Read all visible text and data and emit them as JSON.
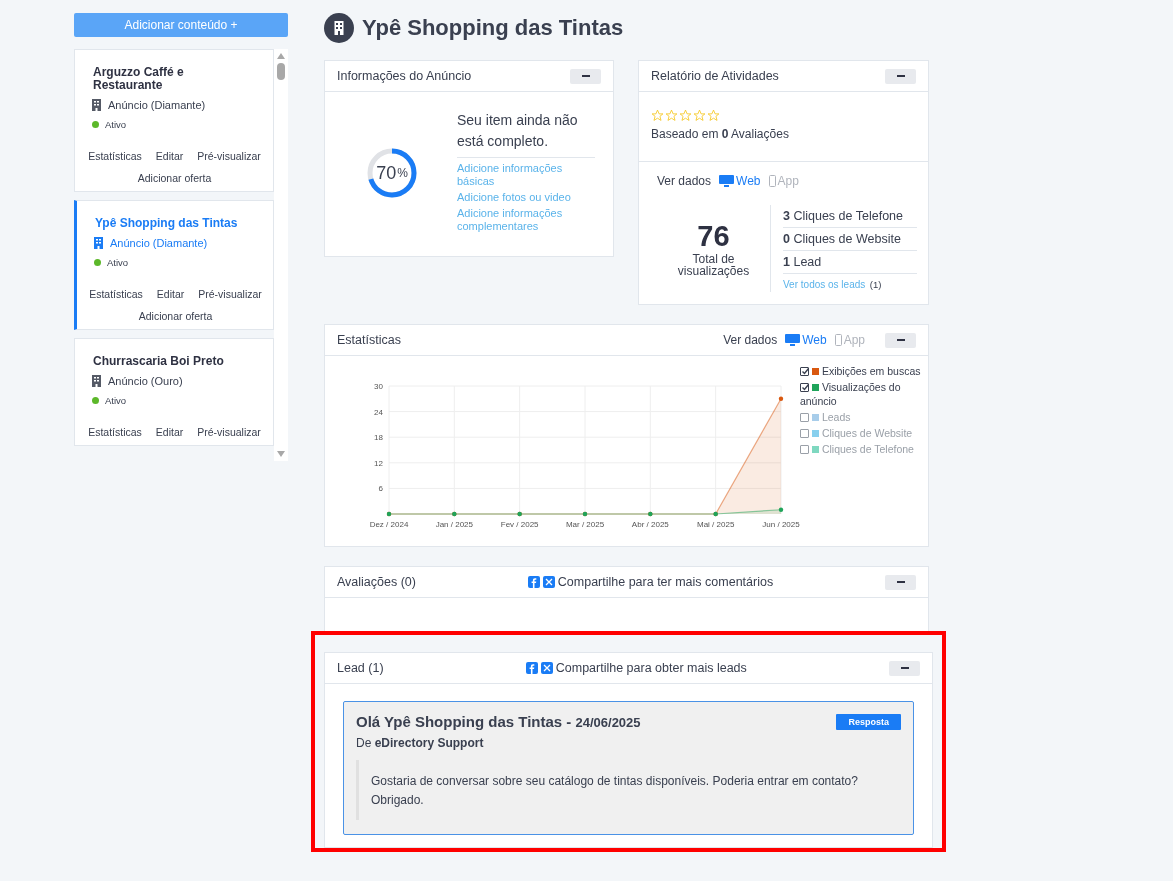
{
  "sidebar": {
    "add_button": "Adicionar conteúdo +",
    "cards": [
      {
        "title": "Arguzzo Caffé e Restaurante",
        "plan": "Anúncio (Diamante)",
        "status": "Ativo",
        "selected": false,
        "actions": [
          "Estatísticas",
          "Editar",
          "Pré-visualizar",
          "Adicionar oferta"
        ]
      },
      {
        "title": "Ypê Shopping das Tintas",
        "plan": "Anúncio (Diamante)",
        "status": "Ativo",
        "selected": true,
        "actions": [
          "Estatísticas",
          "Editar",
          "Pré-visualizar",
          "Adicionar oferta"
        ]
      },
      {
        "title": "Churrascaria Boi Preto",
        "plan": "Anúncio (Ouro)",
        "status": "Ativo",
        "selected": false,
        "actions": [
          "Estatísticas",
          "Editar",
          "Pré-visualizar"
        ]
      }
    ]
  },
  "page_title": "Ypê Shopping das Tintas",
  "info_panel": {
    "title": "Informações do Anúncio",
    "progress": {
      "level": 0.7,
      "value": "70",
      "unit": "%"
    },
    "message": "Seu item ainda não está completo.",
    "links": [
      "Adicione informações básicas",
      "Adicione fotos ou video",
      "Adicione informações complementares"
    ]
  },
  "activity_panel": {
    "title": "Relatório de Atividades",
    "stars": 0,
    "rating_text": "Baseado em **0** Avaliações",
    "view_label": "Ver dados",
    "sources": [
      {
        "label": "Web",
        "kind": "web",
        "selected": true
      },
      {
        "label": "App",
        "kind": "app",
        "selected": false
      }
    ],
    "total": "76",
    "total_label": "Total de visualizações",
    "metrics": [
      "**3** Cliques de Telefone",
      "**0** Cliques de Website",
      "**1** Lead"
    ],
    "leads_link": "Ver todos os leads",
    "leads_count": "(1)"
  },
  "stats_panel": {
    "title": "Estatísticas",
    "view_label": "Ver dados",
    "sources": [
      {
        "label": "Web",
        "kind": "web",
        "selected": true
      },
      {
        "label": "App",
        "kind": "app",
        "selected": false
      }
    ],
    "legend": [
      {
        "label": "Exibições em buscas",
        "checked": true,
        "color": "#d9580f"
      },
      {
        "label": "Visualizações do anúncio",
        "checked": true,
        "color": "#1fa45a"
      },
      {
        "label": "Leads",
        "checked": false,
        "color": "#a8cdea"
      },
      {
        "label": "Cliques de Website",
        "checked": false,
        "color": "#88d0ee"
      },
      {
        "label": "Cliques de Telefone",
        "checked": false,
        "color": "#7fd8c0"
      }
    ],
    "chart_data": {
      "type": "area",
      "grid": true,
      "categories": [
        "Dez / 2024",
        "Jan / 2025",
        "Fev / 2025",
        "Mar / 2025",
        "Abr / 2025",
        "Mai / 2025",
        "Jun / 2025"
      ],
      "ylim": [
        0,
        30
      ],
      "yticks": [
        6,
        12,
        18,
        24,
        30
      ],
      "series": [
        {
          "color": "#d9580f",
          "values": [
            0,
            0,
            0,
            0,
            0,
            0,
            27
          ]
        },
        {
          "color": "#1fa45a",
          "values": [
            0,
            0,
            0,
            0,
            0,
            0,
            1
          ]
        }
      ]
    }
  },
  "reviews_panel": {
    "title": "Avaliações (0)",
    "share_text": "Compartilhe para ter mais comentários"
  },
  "lead_panel": {
    "title": "Lead (1)",
    "share_text": "Compartilhe para obter mais leads",
    "highlighted": true,
    "message": {
      "greeting": "Olá Ypê Shopping das Tintas - ",
      "date": "24/06/2025",
      "reply_button": "Resposta",
      "from": "De **eDirectory Support**",
      "body": "Gostaria de conversar sobre seu catálogo de tintas disponíveis. Poderia entrar em contato? Obrigado."
    }
  }
}
